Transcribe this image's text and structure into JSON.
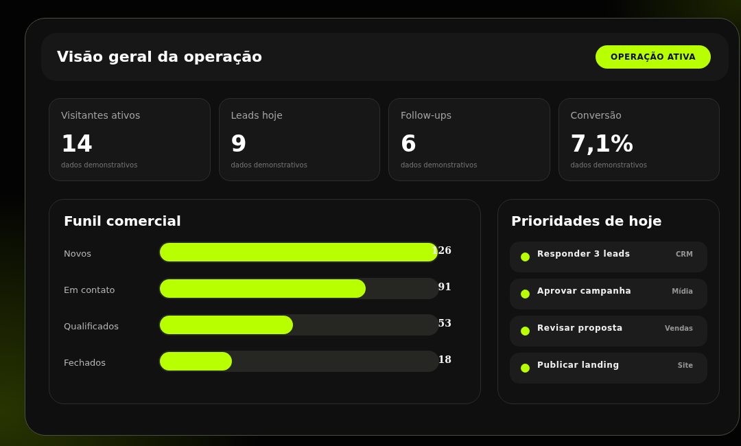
{
  "header": {
    "title": "Visão geral da operação",
    "status_badge": "OPERAÇÃO ATIVA"
  },
  "stats": [
    {
      "label": "Visitantes ativos",
      "value": "14",
      "note": "dados demonstrativos"
    },
    {
      "label": "Leads hoje",
      "value": "9",
      "note": "dados demonstrativos"
    },
    {
      "label": "Follow-ups",
      "value": "6",
      "note": "dados demonstrativos"
    },
    {
      "label": "Conversão",
      "value": "7,1%",
      "note": "dados demonstrativos"
    }
  ],
  "funnel": {
    "title": "Funil comercial",
    "stages": [
      {
        "label": "Novos",
        "value": "126",
        "level": 1
      },
      {
        "label": "Em contato",
        "value": "91",
        "level": 0.74
      },
      {
        "label": "Qualificados",
        "value": "53",
        "level": 0.48
      },
      {
        "label": "Fechados",
        "value": "18",
        "level": 0.26
      }
    ]
  },
  "priorities": {
    "title": "Prioridades de hoje",
    "items": [
      {
        "title": "Responder 3 leads",
        "tag": "CRM"
      },
      {
        "title": "Aprovar campanha",
        "tag": "Mídia"
      },
      {
        "title": "Revisar proposta",
        "tag": "Vendas"
      },
      {
        "title": "Publicar landing",
        "tag": "Site"
      }
    ]
  }
}
